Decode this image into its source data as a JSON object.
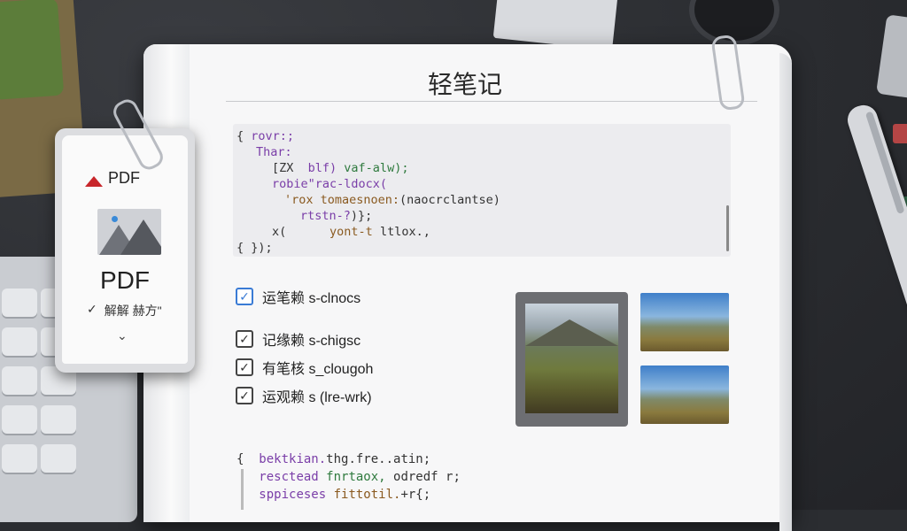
{
  "notebook": {
    "title": "轻笔记"
  },
  "code_block": {
    "lines": [
      [
        {
          "t": "{ ",
          "c": "dark"
        },
        {
          "t": "rovr:;",
          "c": "purple"
        }
      ],
      [
        {
          "t": "Thar:",
          "c": "purple"
        }
      ],
      [
        {
          "t": "[ZX",
          "c": "dark"
        },
        {
          "t": "  blf) ",
          "c": "purple"
        },
        {
          "t": "vaf-alw);",
          "c": "green"
        }
      ],
      [
        {
          "t": "robie\"rac-ldocx(",
          "c": "purple"
        }
      ],
      [
        {
          "t": "'rox tomaesnoen:",
          "c": "brown"
        },
        {
          "t": "(naocrclantse)",
          "c": "dark"
        }
      ],
      [
        {
          "t": "rtstn-?",
          "c": "purple"
        },
        {
          "t": ")};",
          "c": "dark"
        }
      ],
      [
        {
          "t": "x(",
          "c": "dark"
        },
        {
          "t": "      yont-t ",
          "c": "brown"
        },
        {
          "t": "ltlox.,",
          "c": "dark"
        }
      ],
      [
        {
          "t": "{ });",
          "c": "dark"
        }
      ]
    ]
  },
  "checklist": [
    {
      "label": "运笔赖 s-clnocs",
      "checked": true,
      "accent": true
    },
    {
      "label": "记缘赖 s-chigsc",
      "checked": true,
      "accent": false
    },
    {
      "label": "有笔核 s_clougoh",
      "checked": true,
      "accent": false
    },
    {
      "label": "运观赖 s (lre-wrk)",
      "checked": true,
      "accent": false
    }
  ],
  "code_block_2": {
    "lines": [
      [
        {
          "t": "{  ",
          "c": "dark"
        },
        {
          "t": "bektkian.",
          "c": "purple"
        },
        {
          "t": "thg.fre..atin;",
          "c": "dark"
        }
      ],
      [
        {
          "t": "   ",
          "c": "dark"
        },
        {
          "t": "resctead ",
          "c": "purple"
        },
        {
          "t": "fnrtaox, ",
          "c": "green"
        },
        {
          "t": "odredf r;",
          "c": "dark"
        }
      ],
      [
        {
          "t": "   ",
          "c": "dark"
        },
        {
          "t": "sppiceses ",
          "c": "purple"
        },
        {
          "t": "fittotil.",
          "c": "brown"
        },
        {
          "t": "+r{;",
          "c": "dark"
        }
      ]
    ]
  },
  "pdf_card": {
    "header_label": "PDF",
    "title": "PDF",
    "subtitle": "解解 赫方\"",
    "check_glyph": "✓",
    "chevron_glyph": "⌄"
  },
  "colors": {
    "accent": "#3a7bd5",
    "pdf_red": "#c8262b"
  }
}
